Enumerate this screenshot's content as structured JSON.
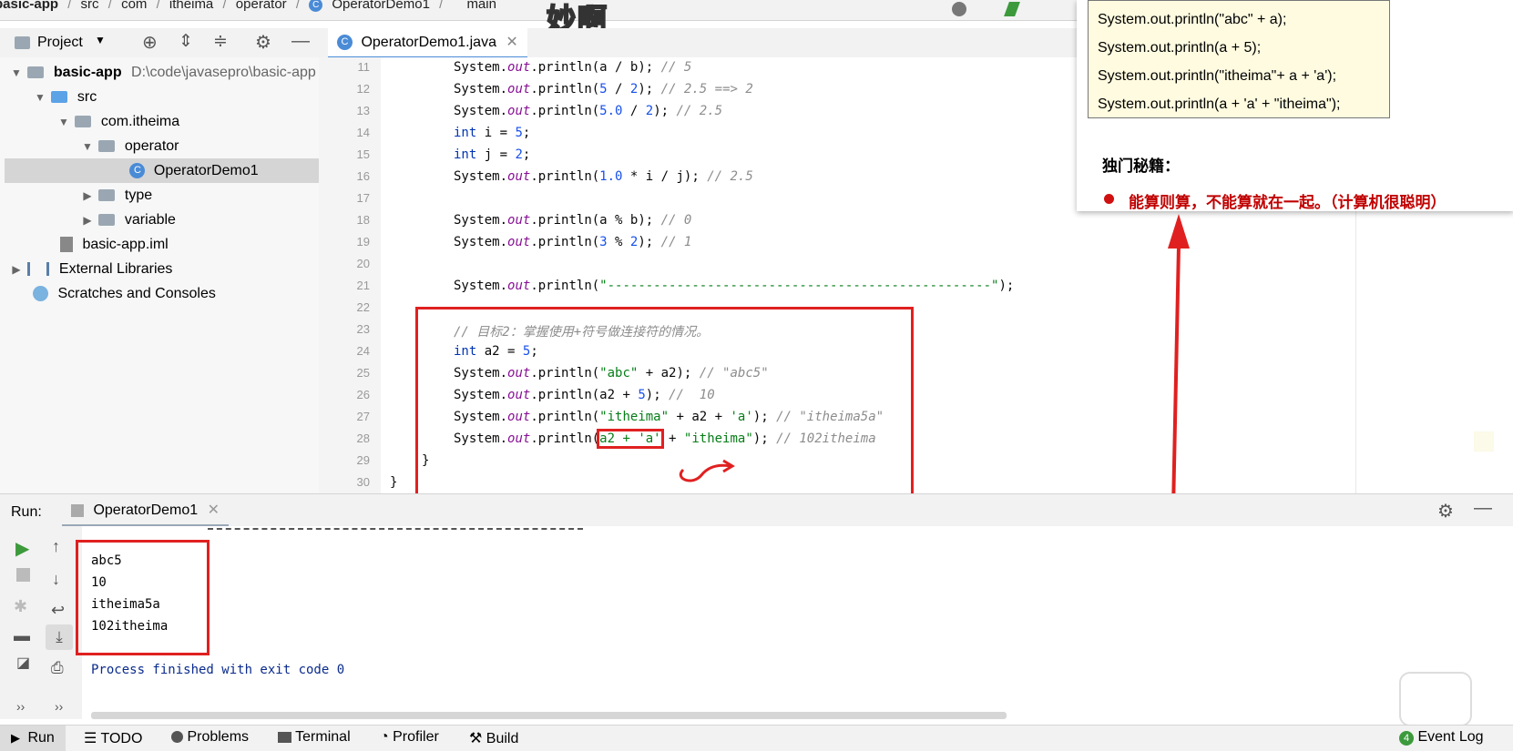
{
  "breadcrumb": [
    "basic-app",
    "src",
    "com",
    "itheima",
    "operator",
    "OperatorDemo1",
    "main"
  ],
  "watermark": "妙啊",
  "project_panel": {
    "title": "Project",
    "tree": [
      {
        "label": "basic-app",
        "extra": "D:\\code\\javasepro\\basic-app"
      },
      {
        "label": "src"
      },
      {
        "label": "com.itheima"
      },
      {
        "label": "operator"
      },
      {
        "label": "OperatorDemo1"
      },
      {
        "label": "type"
      },
      {
        "label": "variable"
      },
      {
        "label": "basic-app.iml"
      },
      {
        "label": "External Libraries"
      },
      {
        "label": "Scratches and Consoles"
      }
    ]
  },
  "editor": {
    "tab_label": "OperatorDemo1.java",
    "line_numbers": [
      "11",
      "12",
      "13",
      "14",
      "15",
      "16",
      "17",
      "18",
      "19",
      "20",
      "21",
      "22",
      "23",
      "24",
      "25",
      "26",
      "27",
      "28",
      "29",
      "30"
    ],
    "lines": {
      "l11": {
        "pre": "System.",
        "field": "out",
        "mid": ".println(a / b); ",
        "comment": "// 5"
      },
      "l12": {
        "pre": "System.",
        "field": "out",
        "mid": ".println(",
        "num1": "5",
        "op": " / ",
        "num2": "2",
        "post": "); ",
        "comment": "// 2.5 ==> 2"
      },
      "l13": {
        "pre": "System.",
        "field": "out",
        "mid": ".println(",
        "num1": "5.0",
        "op": " / ",
        "num2": "2",
        "post": "); ",
        "comment": "// 2.5"
      },
      "l14": {
        "kw": "int",
        "rest": " i = ",
        "num": "5",
        "end": ";"
      },
      "l15": {
        "kw": "int",
        "rest": " j = ",
        "num": "2",
        "end": ";"
      },
      "l16": {
        "pre": "System.",
        "field": "out",
        "mid": ".println(",
        "num1": "1.0",
        "post": " * i / j); ",
        "comment": "// 2.5"
      },
      "l18": {
        "pre": "System.",
        "field": "out",
        "mid": ".println(a % b); ",
        "comment": "// 0"
      },
      "l19": {
        "pre": "System.",
        "field": "out",
        "mid": ".println(",
        "num1": "3",
        "op": " % ",
        "num2": "2",
        "post": "); ",
        "comment": "// 1"
      },
      "l21": {
        "pre": "System.",
        "field": "out",
        "mid": ".println(",
        "str": "\"--------------------------------------------------\"",
        "post": ");"
      },
      "l23": {
        "comment": "// 目标2：掌握使用+符号做连接符的情况。"
      },
      "l24": {
        "kw": "int",
        "rest": " a2 = ",
        "num": "5",
        "end": ";"
      },
      "l25": {
        "pre": "System.",
        "field": "out",
        "mid": ".println(",
        "str": "\"abc\"",
        "post": " + a2); ",
        "comment": "// \"abc5\""
      },
      "l26": {
        "pre": "System.",
        "field": "out",
        "mid": ".println(a2 + ",
        "num1": "5",
        "post": "); ",
        "comment": "//  10"
      },
      "l27": {
        "pre": "System.",
        "field": "out",
        "mid": ".println(",
        "str": "\"itheima\"",
        "post": " + a2 + ",
        "str2": "'a'",
        "post2": "); ",
        "comment": "// \"itheima5a\""
      },
      "l28": {
        "pre": "System.",
        "field": "out",
        "mid": ".println(",
        "box": "a2 + 'a'",
        "post": " + ",
        "str": "\"itheima\"",
        "post2": "); ",
        "comment": "// 102itheima"
      },
      "l29": {
        "brace": "}"
      },
      "l30": {
        "brace": "}"
      }
    }
  },
  "popup": {
    "code_lines": [
      "System.out.println(\"abc\" + a);",
      "System.out.println(a + 5);",
      "System.out.println(\"itheima\"+ a + 'a');",
      "System.out.println(a + 'a' + \"itheima\");"
    ],
    "tip_title": "独门秘籍：",
    "tip_text": "能算则算，不能算就在一起。（计算机很聪明）"
  },
  "run_panel": {
    "label": "Run:",
    "tab": "OperatorDemo1",
    "output": [
      "abc5",
      "10",
      "itheima5a",
      "102itheima"
    ],
    "finish": "Process finished with exit code 0"
  },
  "bottom_bar": {
    "items": [
      "Run",
      "TODO",
      "Problems",
      "Terminal",
      "Profiler",
      "Build"
    ],
    "event_log": "Event Log",
    "event_count": "4"
  },
  "colors": {
    "accent": "#4a8bd6",
    "annotation": "#e02020"
  }
}
